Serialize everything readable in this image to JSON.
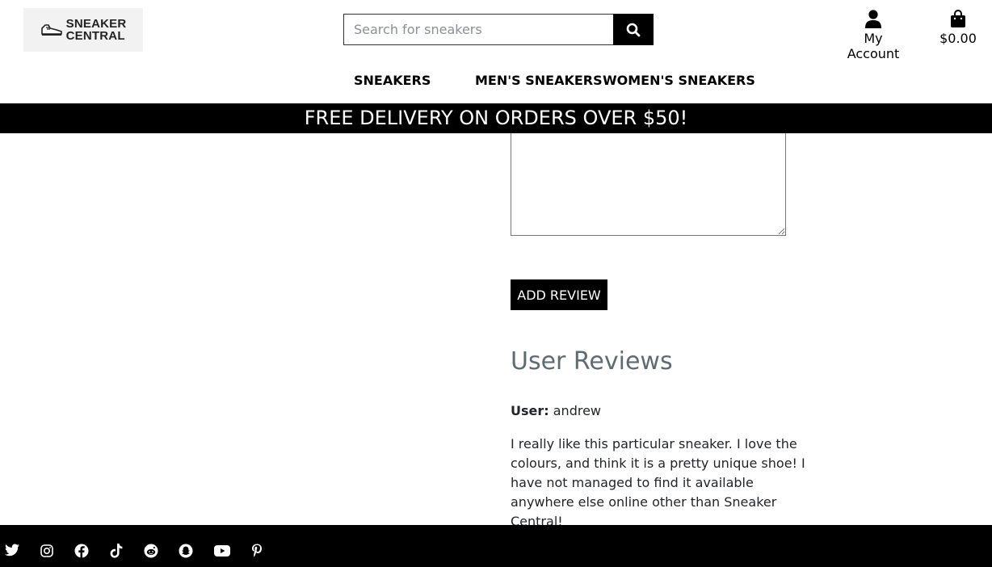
{
  "header": {
    "logo_line1": "SNEAKER",
    "logo_line2": "CENTRAL",
    "search_placeholder": "Search for sneakers",
    "account_label": "My Account",
    "cart_total": "$0.00"
  },
  "nav": {
    "items": [
      {
        "label": "SNEAKERS"
      },
      {
        "label": "MEN'S SNEAKERS"
      },
      {
        "label": "WOMEN'S SNEAKERS"
      }
    ]
  },
  "banner": {
    "text": "FREE DELIVERY ON ORDERS OVER $50!"
  },
  "review_form": {
    "textarea_value": "",
    "submit_label": "ADD REVIEW"
  },
  "reviews": {
    "heading": "User Reviews",
    "items": [
      {
        "user_label": "User:",
        "user": "andrew",
        "body": "I really like this particular sneaker. I love the colours, and think it is a pretty unique shoe! I have not managed to find it available anywhere else online other than Sneaker Central!"
      }
    ]
  },
  "footer": {
    "social_icons": [
      "twitter-icon",
      "instagram-icon",
      "facebook-icon",
      "tiktok-icon",
      "reddit-icon",
      "snapchat-icon",
      "youtube-icon",
      "pinterest-icon"
    ]
  },
  "colors": {
    "primary": "#000000",
    "banner_text": "#ffffff",
    "heading_muted": "#5f6b73"
  }
}
